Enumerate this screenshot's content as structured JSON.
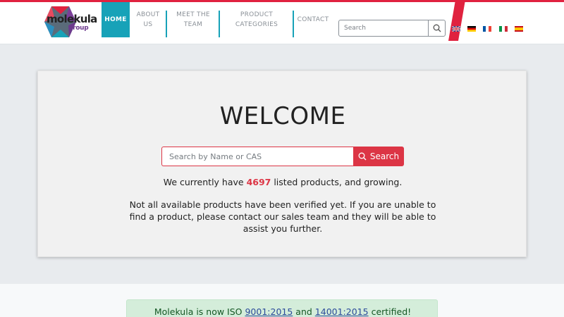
{
  "header": {
    "logo": {
      "main": "molekula",
      "sub": "group"
    },
    "nav": [
      {
        "label_lines": [
          "HOME"
        ],
        "active": true
      },
      {
        "label_lines": [
          "ABOUT",
          "US"
        ],
        "active": false
      },
      {
        "label_lines": [
          "MEET THE",
          "TEAM"
        ],
        "active": false
      },
      {
        "label_lines": [
          "PRODUCT",
          "CATEGORIES"
        ],
        "active": false
      },
      {
        "label_lines": [
          "CONTACT"
        ],
        "active": false
      }
    ],
    "search": {
      "placeholder": "Search",
      "icon": "search-icon"
    },
    "languages": [
      "uk-flag-icon",
      "germany-flag-icon",
      "france-flag-icon",
      "italy-flag-icon",
      "spain-flag-icon"
    ]
  },
  "hero": {
    "title": "WELCOME",
    "search": {
      "placeholder": "Search by Name or CAS",
      "button_label": "Search"
    },
    "count_prefix": "We currently have ",
    "count_value": "4697",
    "count_suffix": " listed products, and growing.",
    "note": "Not all available products have been verified yet. If you are unable to find a product, please contact our sales team and they will be able to assist you further."
  },
  "iso": {
    "prefix": "Molekula is now ISO ",
    "link1": "9001:2015",
    "middle": " and ",
    "link2": "14001:2015",
    "suffix": " certified!"
  },
  "colors": {
    "accent": "#17a2b8",
    "danger": "#dc3545",
    "brand_purple": "#6d3a8e"
  }
}
